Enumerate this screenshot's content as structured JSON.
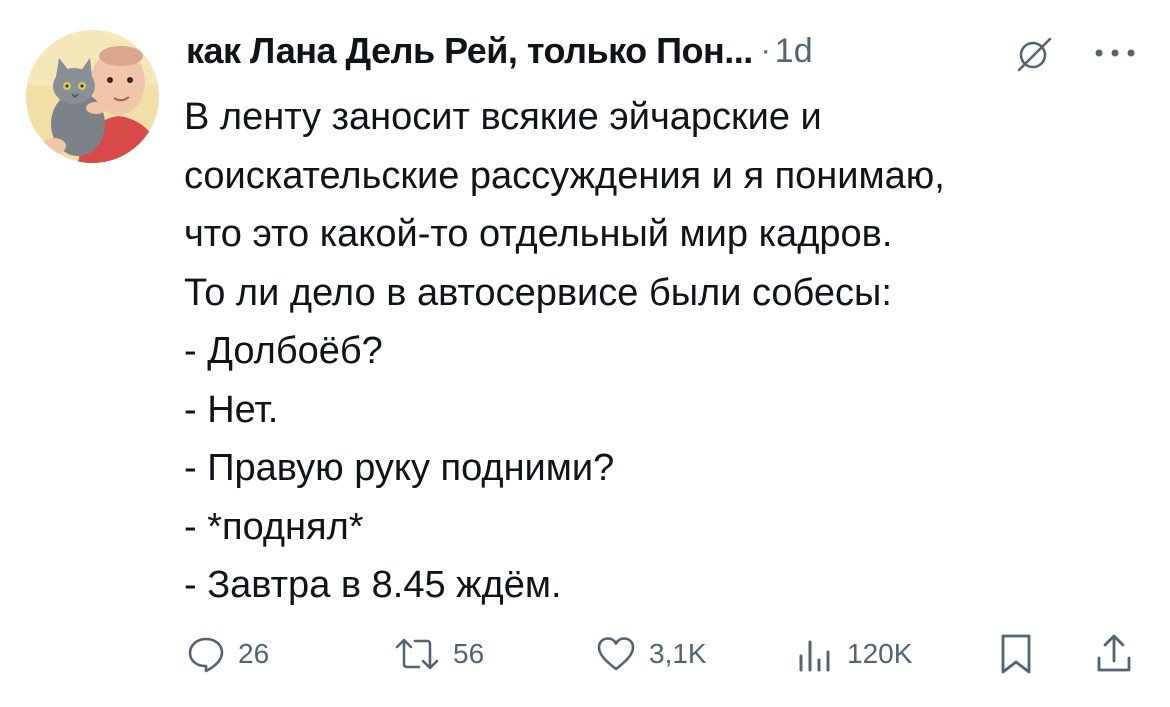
{
  "tweet": {
    "author": {
      "display_name": "как Лана Дель Рей, только Пон...",
      "avatar_icon": "avatar-man-holding-cat"
    },
    "separator": "·",
    "timestamp": "1d",
    "lines": [
      "В ленту заносит всякие эйчарские и",
      "соискательские рассуждения и я понимаю,",
      "что это какой-то отдельный мир кадров.",
      "То ли дело в автосервисе были собесы:",
      "- Долбоёб?",
      "- Нет.",
      "- Правую руку подними?",
      "- *поднял*",
      "- Завтра в 8.45 ждём."
    ],
    "actions": {
      "reply": {
        "icon": "reply-icon",
        "count": "26"
      },
      "retweet": {
        "icon": "retweet-icon",
        "count": "56"
      },
      "like": {
        "icon": "heart-icon",
        "count": "3,1K"
      },
      "views": {
        "icon": "views-chart-icon",
        "count": "120K"
      },
      "bookmark": {
        "icon": "bookmark-icon"
      },
      "share": {
        "icon": "share-icon"
      }
    },
    "colors": {
      "text": "#0f1419",
      "secondary": "#536471",
      "background": "#ffffff"
    }
  }
}
